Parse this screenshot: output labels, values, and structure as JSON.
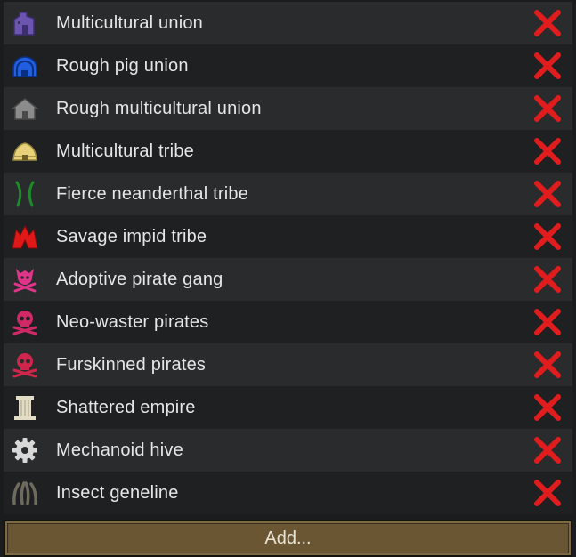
{
  "factions": [
    {
      "name": "Multicultural union",
      "icon": "purple-building-icon",
      "color": "#6b55b0"
    },
    {
      "name": "Rough pig union",
      "icon": "blue-dome-icon",
      "color": "#1f5fe0"
    },
    {
      "name": "Rough multicultural union",
      "icon": "gray-house-icon",
      "color": "#8c8c8c"
    },
    {
      "name": "Multicultural tribe",
      "icon": "yellow-hut-icon",
      "color": "#e7d27a"
    },
    {
      "name": "Fierce neanderthal tribe",
      "icon": "green-crossed-sticks-icon",
      "color": "#1f8a2a"
    },
    {
      "name": "Savage impid tribe",
      "icon": "red-tent-icon",
      "color": "#e01818"
    },
    {
      "name": "Adoptive pirate gang",
      "icon": "pink-skull-icon",
      "color": "#e0348a"
    },
    {
      "name": "Neo-waster pirates",
      "icon": "magenta-skull-icon",
      "color": "#d02a66"
    },
    {
      "name": "Furskinned pirates",
      "icon": "crimson-skull-icon",
      "color": "#d0264c"
    },
    {
      "name": "Shattered empire",
      "icon": "pillar-icon",
      "color": "#e2ddc4"
    },
    {
      "name": "Mechanoid hive",
      "icon": "gear-icon",
      "color": "#d8d8d8"
    },
    {
      "name": "Insect geneline",
      "icon": "claws-icon",
      "color": "#6e6a5e"
    }
  ],
  "remove_icon": "red-x-icon",
  "remove_color": "#e01c1c",
  "add_button_label": "Add..."
}
